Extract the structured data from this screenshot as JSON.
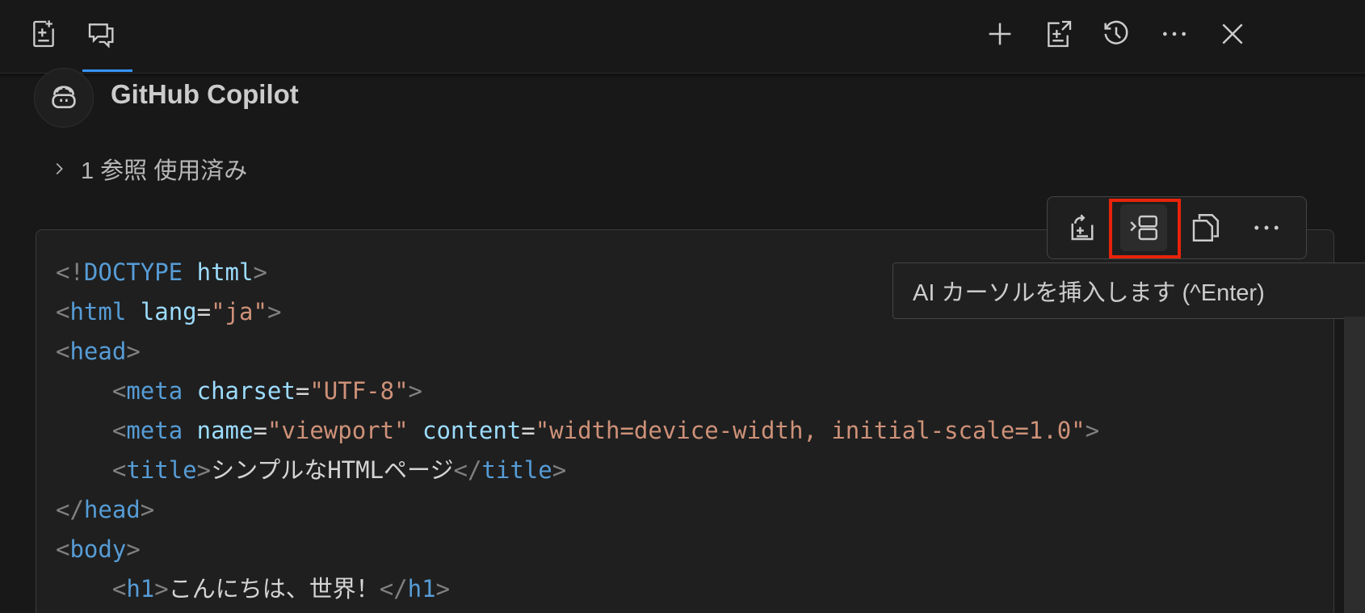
{
  "header": {
    "tabs": [
      {
        "icon": "new-file-icon"
      },
      {
        "icon": "chat-icon",
        "active": true
      }
    ],
    "actions": [
      {
        "icon": "plus-icon"
      },
      {
        "icon": "open-editor-icon"
      },
      {
        "icon": "history-icon"
      },
      {
        "icon": "more-icon"
      },
      {
        "icon": "close-icon"
      }
    ]
  },
  "message": {
    "agent": "GitHub Copilot",
    "avatar_icon": "copilot-icon",
    "references_label": "1 参照 使用済み"
  },
  "code_toolbar": {
    "buttons": [
      {
        "icon": "apply-in-editor-icon"
      },
      {
        "icon": "insert-at-cursor-icon",
        "highlighted": true
      },
      {
        "icon": "copy-icon"
      },
      {
        "icon": "more-icon"
      }
    ],
    "tooltip": "AI カーソルを挿入します (^Enter)"
  },
  "code": {
    "lines": [
      {
        "indent": "",
        "tokens": [
          {
            "t": "<!",
            "c": "p"
          },
          {
            "t": "DOCTYPE",
            "c": "t"
          },
          {
            "t": " ",
            "c": "x"
          },
          {
            "t": "html",
            "c": "a"
          },
          {
            "t": ">",
            "c": "p"
          }
        ]
      },
      {
        "indent": "",
        "tokens": [
          {
            "t": "<",
            "c": "p"
          },
          {
            "t": "html",
            "c": "t"
          },
          {
            "t": " ",
            "c": "x"
          },
          {
            "t": "lang",
            "c": "a"
          },
          {
            "t": "=",
            "c": "x"
          },
          {
            "t": "\"ja\"",
            "c": "s"
          },
          {
            "t": ">",
            "c": "p"
          }
        ]
      },
      {
        "indent": "",
        "tokens": [
          {
            "t": "<",
            "c": "p"
          },
          {
            "t": "head",
            "c": "t"
          },
          {
            "t": ">",
            "c": "p"
          }
        ]
      },
      {
        "indent": "    ",
        "tokens": [
          {
            "t": "<",
            "c": "p"
          },
          {
            "t": "meta",
            "c": "t"
          },
          {
            "t": " ",
            "c": "x"
          },
          {
            "t": "charset",
            "c": "a"
          },
          {
            "t": "=",
            "c": "x"
          },
          {
            "t": "\"UTF-8\"",
            "c": "s"
          },
          {
            "t": ">",
            "c": "p"
          }
        ]
      },
      {
        "indent": "    ",
        "tokens": [
          {
            "t": "<",
            "c": "p"
          },
          {
            "t": "meta",
            "c": "t"
          },
          {
            "t": " ",
            "c": "x"
          },
          {
            "t": "name",
            "c": "a"
          },
          {
            "t": "=",
            "c": "x"
          },
          {
            "t": "\"viewport\"",
            "c": "s"
          },
          {
            "t": " ",
            "c": "x"
          },
          {
            "t": "content",
            "c": "a"
          },
          {
            "t": "=",
            "c": "x"
          },
          {
            "t": "\"width=device-width, initial-scale=1.0\"",
            "c": "s"
          },
          {
            "t": ">",
            "c": "p"
          }
        ]
      },
      {
        "indent": "    ",
        "tokens": [
          {
            "t": "<",
            "c": "p"
          },
          {
            "t": "title",
            "c": "t"
          },
          {
            "t": ">",
            "c": "p"
          },
          {
            "t": "シンプルなHTMLページ",
            "c": "x"
          },
          {
            "t": "</",
            "c": "p"
          },
          {
            "t": "title",
            "c": "t"
          },
          {
            "t": ">",
            "c": "p"
          }
        ]
      },
      {
        "indent": "",
        "tokens": [
          {
            "t": "</",
            "c": "p"
          },
          {
            "t": "head",
            "c": "t"
          },
          {
            "t": ">",
            "c": "p"
          }
        ]
      },
      {
        "indent": "",
        "tokens": [
          {
            "t": "<",
            "c": "p"
          },
          {
            "t": "body",
            "c": "t"
          },
          {
            "t": ">",
            "c": "p"
          }
        ]
      },
      {
        "indent": "    ",
        "tokens": [
          {
            "t": "<",
            "c": "p"
          },
          {
            "t": "h1",
            "c": "t"
          },
          {
            "t": ">",
            "c": "p"
          },
          {
            "t": "こんにちは、世界！",
            "c": "x"
          },
          {
            "t": "</",
            "c": "p"
          },
          {
            "t": "h1",
            "c": "t"
          },
          {
            "t": ">",
            "c": "p"
          }
        ]
      }
    ]
  },
  "colors": {
    "background": "#181818",
    "code_background": "#1f1f1f",
    "tag": "#569cd6",
    "attribute": "#9cdcfe",
    "string": "#ce9178",
    "punctuation": "#808080",
    "highlight": "#e8230a",
    "active_tab": "#3794ff"
  }
}
